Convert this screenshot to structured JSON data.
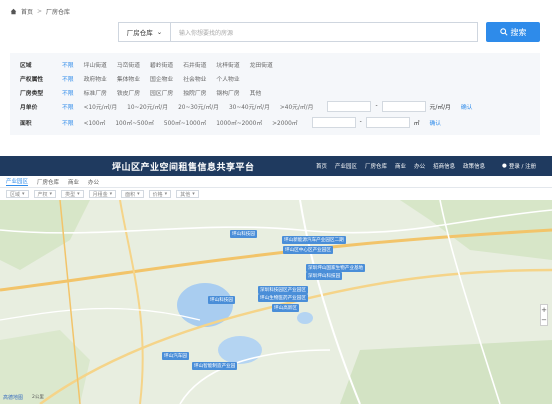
{
  "top": {
    "breadcrumb": {
      "home": "首页",
      "current": "厂房仓库"
    },
    "search": {
      "type_selected": "厂房仓库",
      "placeholder": "输入你想要找的房源",
      "button_label": "搜索"
    },
    "filters": [
      {
        "label": "区域",
        "options": [
          "不限",
          "坪山街道",
          "马峦街道",
          "碧岭街道",
          "石井街道",
          "坑梓街道",
          "龙田街道"
        ],
        "active": 0
      },
      {
        "label": "产权属性",
        "options": [
          "不限",
          "政府物业",
          "集体物业",
          "国企物业",
          "社会物业",
          "个人物业"
        ],
        "active": 0
      },
      {
        "label": "厂房类型",
        "options": [
          "不限",
          "标准厂房",
          "铁皮厂房",
          "园区厂房",
          "独院厂房",
          "钢构厂房",
          "其他"
        ],
        "active": 0
      },
      {
        "label": "月单价",
        "options": [
          "不限",
          "<10元/㎡/月",
          "10~20元/㎡/月",
          "20~30元/㎡/月",
          "30~40元/㎡/月",
          ">40元/㎡/月"
        ],
        "active": 0,
        "range_unit": "元/㎡/月",
        "confirm": "确认"
      },
      {
        "label": "面积",
        "options": [
          "不限",
          "<100㎡",
          "100㎡~500㎡",
          "500㎡~1000㎡",
          "1000㎡~2000㎡",
          ">2000㎡"
        ],
        "active": 0,
        "range_unit": "㎡",
        "confirm": "确认"
      }
    ]
  },
  "bottom": {
    "title": "坪山区产业空间租售信息共享平台",
    "nav": [
      "首页",
      "产业园区",
      "厂房仓库",
      "商业",
      "办公",
      "招商信息",
      "政策信息"
    ],
    "user": "登录 / 注册",
    "tabs": [
      {
        "label": "产业园区",
        "active": true
      },
      {
        "label": "厂房仓库",
        "active": false
      },
      {
        "label": "商业",
        "active": false
      },
      {
        "label": "办公",
        "active": false
      }
    ],
    "controls": [
      "区域",
      "产权",
      "类型",
      "月租金",
      "面积",
      "价格",
      "其他"
    ],
    "map": {
      "pins": [
        {
          "label": "坪山科技园"
        },
        {
          "label": "坪山新能源汽车产业园区二期"
        },
        {
          "label": "坪山区中心区产业园区"
        },
        {
          "label": "深圳坪山国家生物产业基地"
        },
        {
          "label": "深圳坪山科技园"
        },
        {
          "label": "深圳科技园区产业园区"
        },
        {
          "label": "坪山生物医药产业园区"
        },
        {
          "label": "坪山高新区"
        },
        {
          "label": "坪山科技园"
        },
        {
          "label": "坪山汽车园"
        },
        {
          "label": "坪山智能制造产业园"
        }
      ],
      "logo": "高德地图",
      "scale": "2公里"
    }
  }
}
